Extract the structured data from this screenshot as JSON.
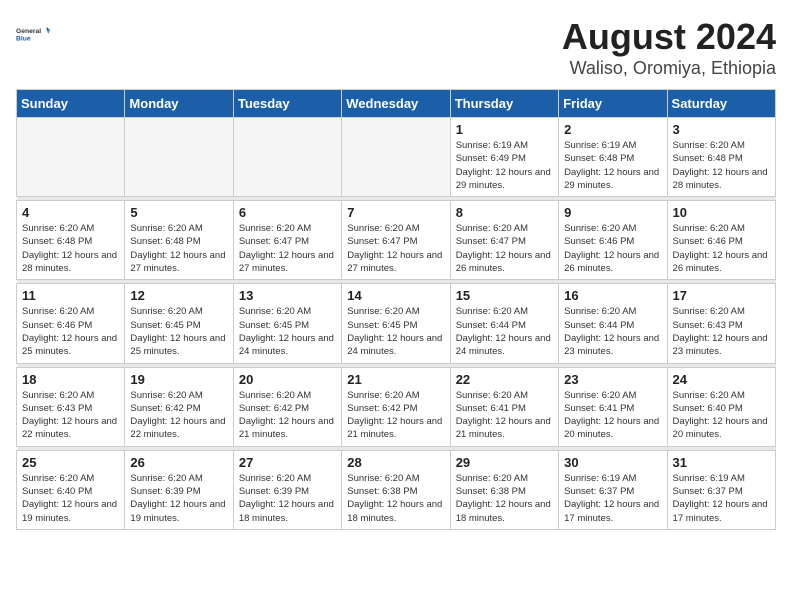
{
  "logo": {
    "text_general": "General",
    "text_blue": "Blue"
  },
  "title": "August 2024",
  "subtitle": "Waliso, Oromiya, Ethiopia",
  "days_of_week": [
    "Sunday",
    "Monday",
    "Tuesday",
    "Wednesday",
    "Thursday",
    "Friday",
    "Saturday"
  ],
  "weeks": [
    [
      {
        "day": "",
        "empty": true
      },
      {
        "day": "",
        "empty": true
      },
      {
        "day": "",
        "empty": true
      },
      {
        "day": "",
        "empty": true
      },
      {
        "day": "1",
        "sunrise": "6:19 AM",
        "sunset": "6:49 PM",
        "daylight": "12 hours and 29 minutes."
      },
      {
        "day": "2",
        "sunrise": "6:19 AM",
        "sunset": "6:48 PM",
        "daylight": "12 hours and 29 minutes."
      },
      {
        "day": "3",
        "sunrise": "6:20 AM",
        "sunset": "6:48 PM",
        "daylight": "12 hours and 28 minutes."
      }
    ],
    [
      {
        "day": "4",
        "sunrise": "6:20 AM",
        "sunset": "6:48 PM",
        "daylight": "12 hours and 28 minutes."
      },
      {
        "day": "5",
        "sunrise": "6:20 AM",
        "sunset": "6:48 PM",
        "daylight": "12 hours and 27 minutes."
      },
      {
        "day": "6",
        "sunrise": "6:20 AM",
        "sunset": "6:47 PM",
        "daylight": "12 hours and 27 minutes."
      },
      {
        "day": "7",
        "sunrise": "6:20 AM",
        "sunset": "6:47 PM",
        "daylight": "12 hours and 27 minutes."
      },
      {
        "day": "8",
        "sunrise": "6:20 AM",
        "sunset": "6:47 PM",
        "daylight": "12 hours and 26 minutes."
      },
      {
        "day": "9",
        "sunrise": "6:20 AM",
        "sunset": "6:46 PM",
        "daylight": "12 hours and 26 minutes."
      },
      {
        "day": "10",
        "sunrise": "6:20 AM",
        "sunset": "6:46 PM",
        "daylight": "12 hours and 26 minutes."
      }
    ],
    [
      {
        "day": "11",
        "sunrise": "6:20 AM",
        "sunset": "6:46 PM",
        "daylight": "12 hours and 25 minutes."
      },
      {
        "day": "12",
        "sunrise": "6:20 AM",
        "sunset": "6:45 PM",
        "daylight": "12 hours and 25 minutes."
      },
      {
        "day": "13",
        "sunrise": "6:20 AM",
        "sunset": "6:45 PM",
        "daylight": "12 hours and 24 minutes."
      },
      {
        "day": "14",
        "sunrise": "6:20 AM",
        "sunset": "6:45 PM",
        "daylight": "12 hours and 24 minutes."
      },
      {
        "day": "15",
        "sunrise": "6:20 AM",
        "sunset": "6:44 PM",
        "daylight": "12 hours and 24 minutes."
      },
      {
        "day": "16",
        "sunrise": "6:20 AM",
        "sunset": "6:44 PM",
        "daylight": "12 hours and 23 minutes."
      },
      {
        "day": "17",
        "sunrise": "6:20 AM",
        "sunset": "6:43 PM",
        "daylight": "12 hours and 23 minutes."
      }
    ],
    [
      {
        "day": "18",
        "sunrise": "6:20 AM",
        "sunset": "6:43 PM",
        "daylight": "12 hours and 22 minutes."
      },
      {
        "day": "19",
        "sunrise": "6:20 AM",
        "sunset": "6:42 PM",
        "daylight": "12 hours and 22 minutes."
      },
      {
        "day": "20",
        "sunrise": "6:20 AM",
        "sunset": "6:42 PM",
        "daylight": "12 hours and 21 minutes."
      },
      {
        "day": "21",
        "sunrise": "6:20 AM",
        "sunset": "6:42 PM",
        "daylight": "12 hours and 21 minutes."
      },
      {
        "day": "22",
        "sunrise": "6:20 AM",
        "sunset": "6:41 PM",
        "daylight": "12 hours and 21 minutes."
      },
      {
        "day": "23",
        "sunrise": "6:20 AM",
        "sunset": "6:41 PM",
        "daylight": "12 hours and 20 minutes."
      },
      {
        "day": "24",
        "sunrise": "6:20 AM",
        "sunset": "6:40 PM",
        "daylight": "12 hours and 20 minutes."
      }
    ],
    [
      {
        "day": "25",
        "sunrise": "6:20 AM",
        "sunset": "6:40 PM",
        "daylight": "12 hours and 19 minutes."
      },
      {
        "day": "26",
        "sunrise": "6:20 AM",
        "sunset": "6:39 PM",
        "daylight": "12 hours and 19 minutes."
      },
      {
        "day": "27",
        "sunrise": "6:20 AM",
        "sunset": "6:39 PM",
        "daylight": "12 hours and 18 minutes."
      },
      {
        "day": "28",
        "sunrise": "6:20 AM",
        "sunset": "6:38 PM",
        "daylight": "12 hours and 18 minutes."
      },
      {
        "day": "29",
        "sunrise": "6:20 AM",
        "sunset": "6:38 PM",
        "daylight": "12 hours and 18 minutes."
      },
      {
        "day": "30",
        "sunrise": "6:19 AM",
        "sunset": "6:37 PM",
        "daylight": "12 hours and 17 minutes."
      },
      {
        "day": "31",
        "sunrise": "6:19 AM",
        "sunset": "6:37 PM",
        "daylight": "12 hours and 17 minutes."
      }
    ]
  ]
}
